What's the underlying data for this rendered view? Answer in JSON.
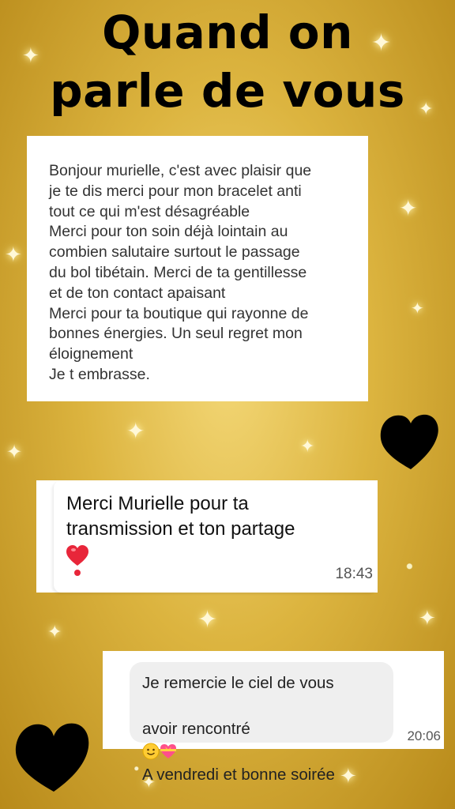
{
  "title": {
    "line1": "Quand on",
    "line2": "parle de vous"
  },
  "message1": {
    "text": "Bonjour murielle, c'est avec plaisir que\nje te dis merci pour mon bracelet anti\ntout ce qui m'est désagréable\nMerci pour ton soin  déjà lointain au\ncombien salutaire surtout le passage\ndu bol tibétain. Merci de ta gentillesse\net de ton contact apaisant\nMerci pour ta boutique qui rayonne de\nbonnes énergies. Un seul regret mon\néloignement\nJe  t embrasse."
  },
  "message2": {
    "line1": "Merci Murielle pour ta",
    "line2": "transmission et ton partage",
    "emoji": "red-heart-exclamation-icon",
    "time": "18:43"
  },
  "message3": {
    "line1": "Je remercie le ciel de vous",
    "line2": "avoir rencontré",
    "line3": "A vendredi et bonne soirée",
    "emojis": [
      "smiling-face-icon",
      "heart-with-ribbon-icon"
    ],
    "time": "20:06"
  },
  "decorations": {
    "hearts": [
      "black-heart-icon",
      "black-heart-icon"
    ],
    "heart_color": "#000000",
    "accent": "#e8c24a"
  }
}
